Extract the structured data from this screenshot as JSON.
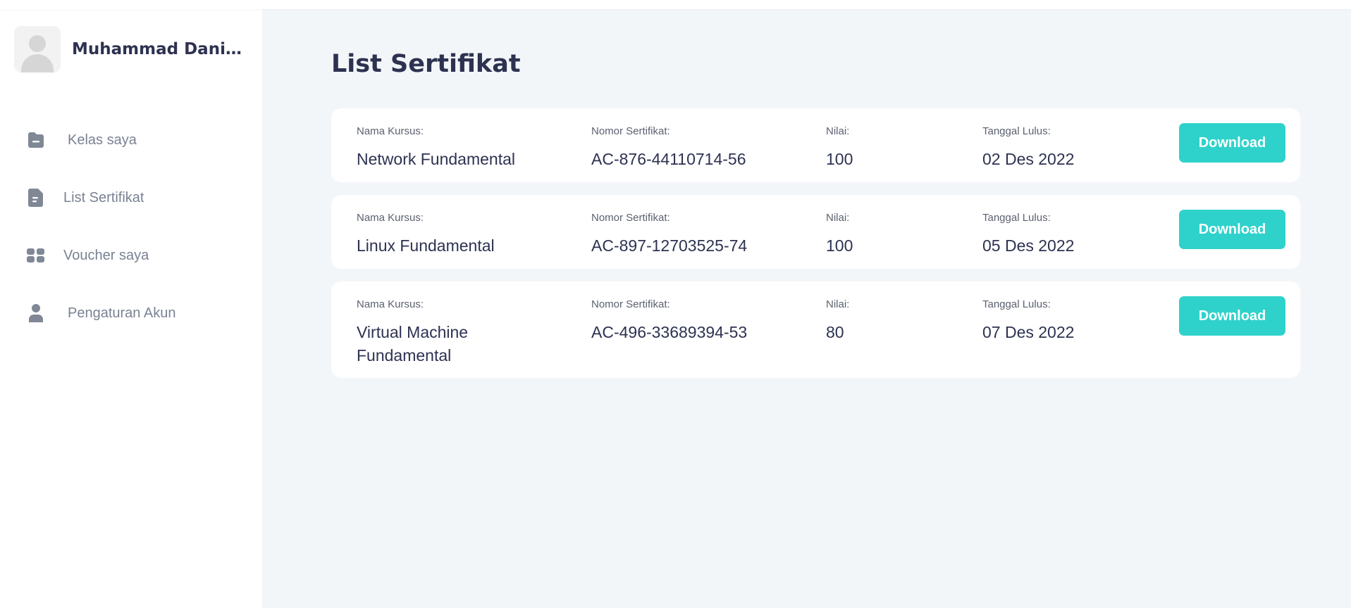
{
  "user": {
    "name": "Muhammad Danish Adz Dzakwan"
  },
  "sidebar": {
    "items": [
      {
        "label": "Kelas saya",
        "icon": "folder-icon"
      },
      {
        "label": "List Sertifikat",
        "icon": "document-icon"
      },
      {
        "label": "Voucher saya",
        "icon": "voucher-icon"
      },
      {
        "label": "Pengaturan Akun",
        "icon": "user-icon"
      }
    ]
  },
  "page": {
    "title": "List Sertifikat"
  },
  "labels": {
    "course": "Nama Kursus:",
    "number": "Nomor Sertifikat:",
    "score": "Nilai:",
    "date": "Tanggal Lulus:",
    "download": "Download"
  },
  "certificates": [
    {
      "course": "Network Fundamental",
      "number": "AC-876-44110714-56",
      "score": "100",
      "date": "02 Des 2022"
    },
    {
      "course": "Linux Fundamental",
      "number": "AC-897-12703525-74",
      "score": "100",
      "date": "05 Des 2022"
    },
    {
      "course": "Virtual Machine Fundamental",
      "number": "AC-496-33689394-53",
      "score": "80",
      "date": "07 Des 2022"
    }
  ],
  "colors": {
    "accent": "#2fd2cb",
    "text_dark": "#2d3251",
    "text_muted": "#7a8293",
    "background": "#f3f6f9"
  }
}
